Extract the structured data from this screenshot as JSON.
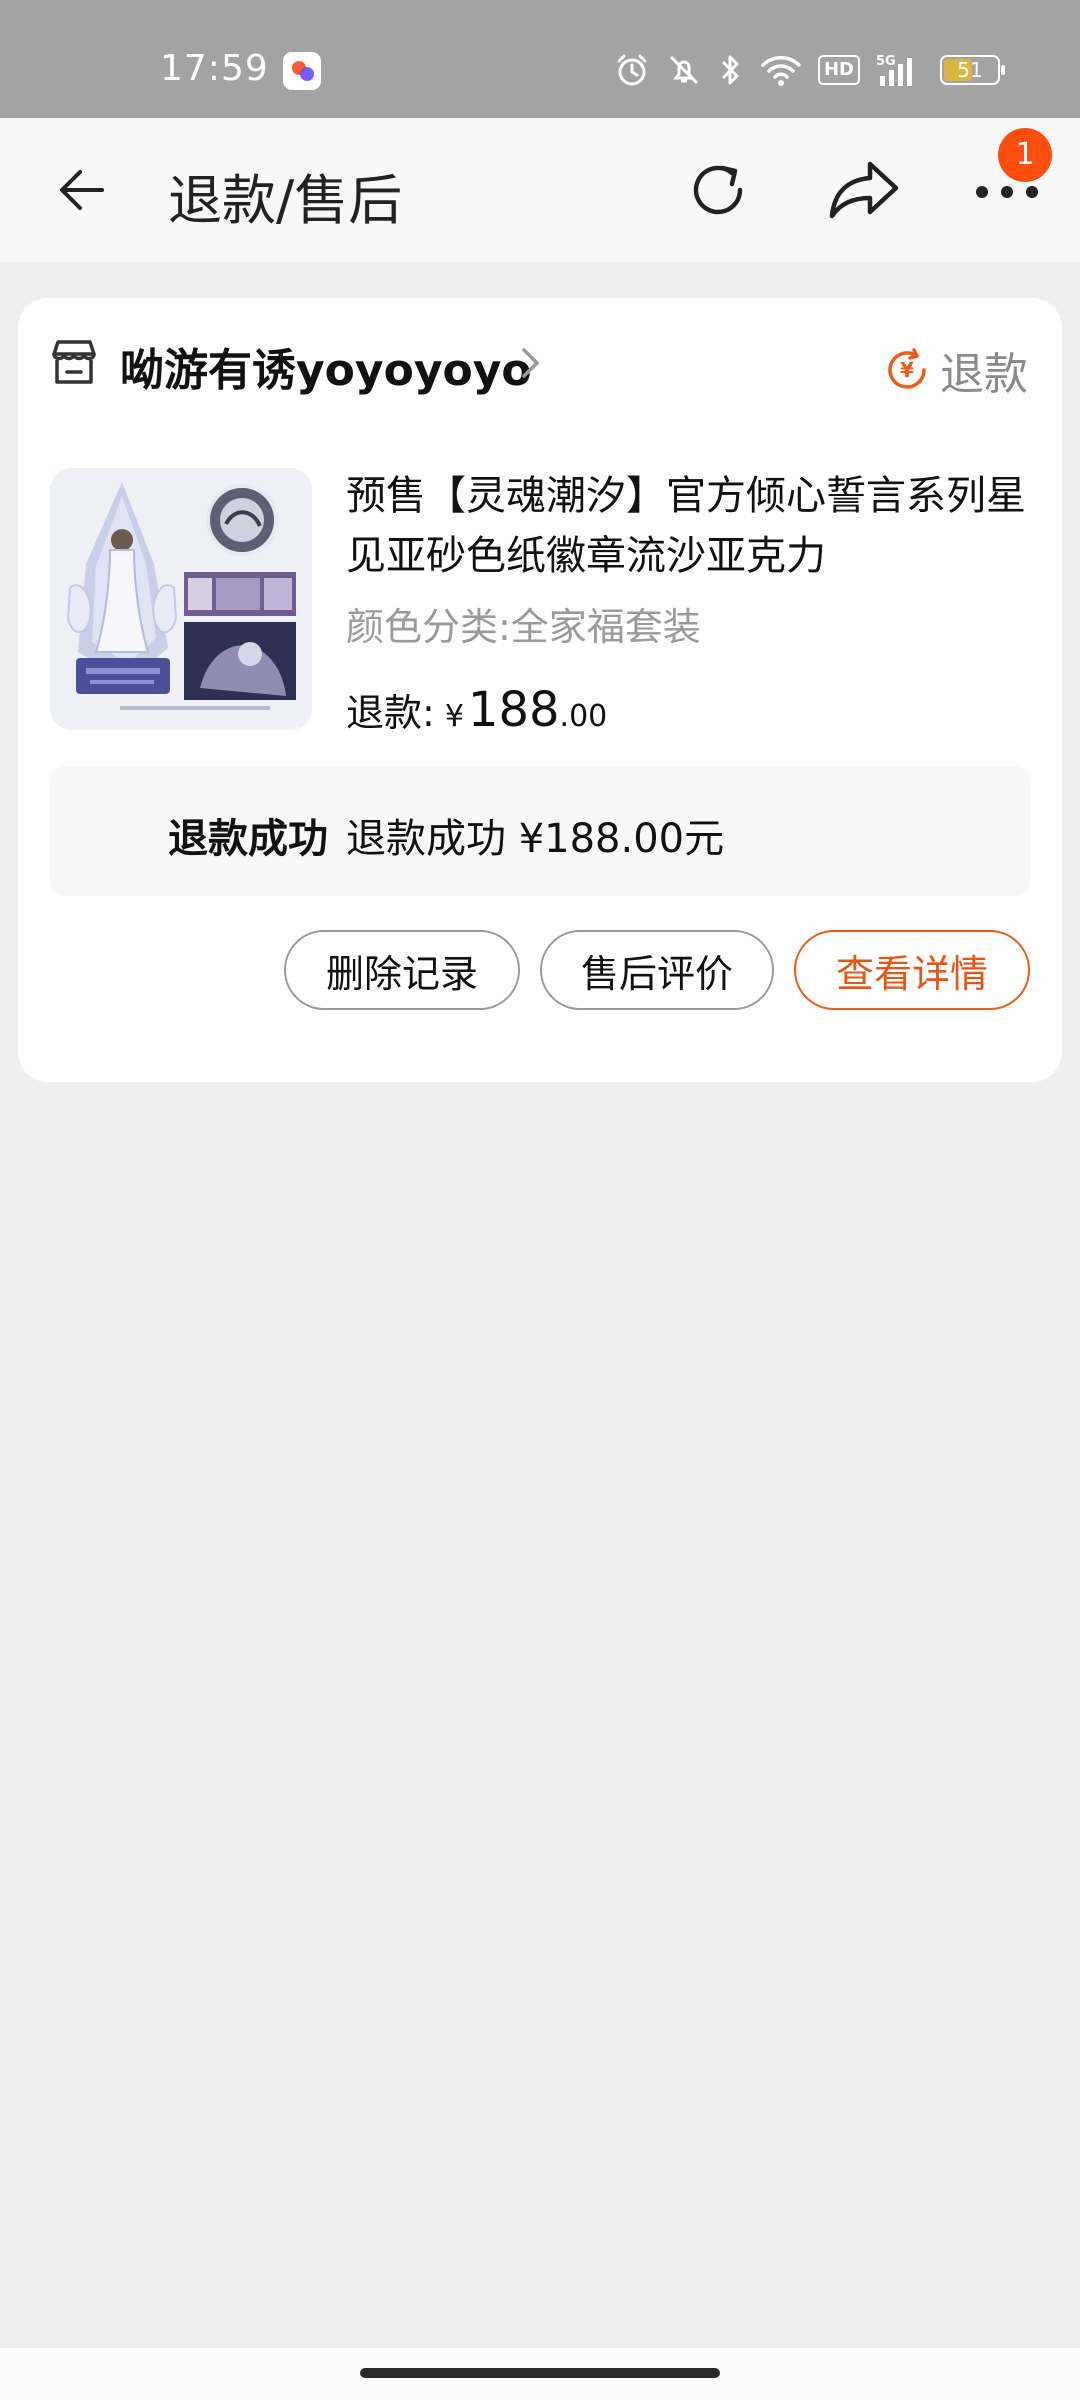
{
  "status_bar": {
    "time": "17:59",
    "hd_label": "HD",
    "network_label": "5G",
    "battery": "51",
    "icons": [
      "alarm-icon",
      "mute-icon",
      "bluetooth-icon",
      "wifi-icon",
      "hd-icon",
      "signal-icon",
      "battery-icon"
    ]
  },
  "nav": {
    "title": "退款/售后",
    "notification_count": "1",
    "icons": [
      "back-arrow-icon",
      "refresh-icon",
      "share-icon",
      "more-icon"
    ]
  },
  "order": {
    "shop_name": "呦游有诱yoyoyoyo",
    "refund_tag": "退款",
    "product_title": "预售【灵魂潮汐】官方倾心誓言系列星见亚砂色纸徽章流沙亚克力",
    "sku": "颜色分类:全家福套装",
    "refund_label": "退款:",
    "currency": "¥",
    "amount_int": "188",
    "amount_dec": ".00",
    "status_label": "退款成功",
    "status_desc": "退款成功 ¥188.00元"
  },
  "actions": {
    "delete": "删除记录",
    "review": "售后评价",
    "detail": "查看详情"
  },
  "colors": {
    "accent": "#f05a14",
    "badge": "#ff4d0d",
    "status_bar_bg": "#a3a3a3",
    "page_bg": "#efefef"
  }
}
